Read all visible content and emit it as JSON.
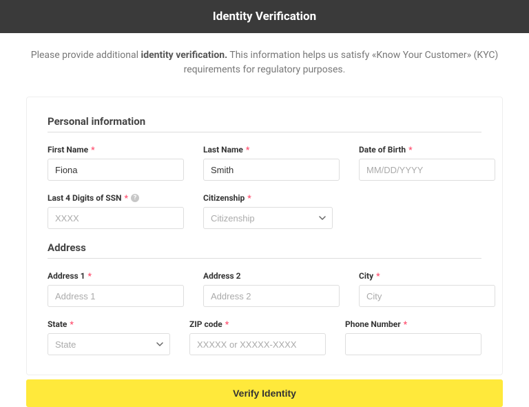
{
  "header": {
    "title": "Identity Verification"
  },
  "intro": {
    "prefix": "Please provide additional ",
    "strong": "identity verification.",
    "suffix": " This information helps us satisfy «Know Your Customer» (KYC) requirements for regulatory purposes."
  },
  "sections": {
    "personal": {
      "title": "Personal information",
      "first_name": {
        "label": "First Name",
        "value": "Fiona",
        "required": true
      },
      "last_name": {
        "label": "Last Name",
        "value": "Smith",
        "required": true
      },
      "dob": {
        "label": "Date of Birth",
        "placeholder": "MM/DD/YYYY",
        "required": true
      },
      "ssn4": {
        "label": "Last 4 Digits of SSN",
        "placeholder": "XXXX",
        "required": true,
        "help": "?"
      },
      "citizenship": {
        "label": "Citizenship",
        "placeholder": "Citizenship",
        "required": true
      }
    },
    "address": {
      "title": "Address",
      "address1": {
        "label": "Address 1",
        "placeholder": "Address 1",
        "required": true
      },
      "address2": {
        "label": "Address 2",
        "placeholder": "Address 2",
        "required": false
      },
      "city": {
        "label": "City",
        "placeholder": "City",
        "required": true
      },
      "state": {
        "label": "State",
        "placeholder": "State",
        "required": true
      },
      "zip": {
        "label": "ZIP code",
        "placeholder": "XXXXX or XXXXX-XXXX",
        "required": true
      },
      "phone": {
        "label": "Phone Number",
        "placeholder": "",
        "required": true
      }
    }
  },
  "actions": {
    "verify": "Verify Identity"
  },
  "marks": {
    "asterisk": "*"
  }
}
